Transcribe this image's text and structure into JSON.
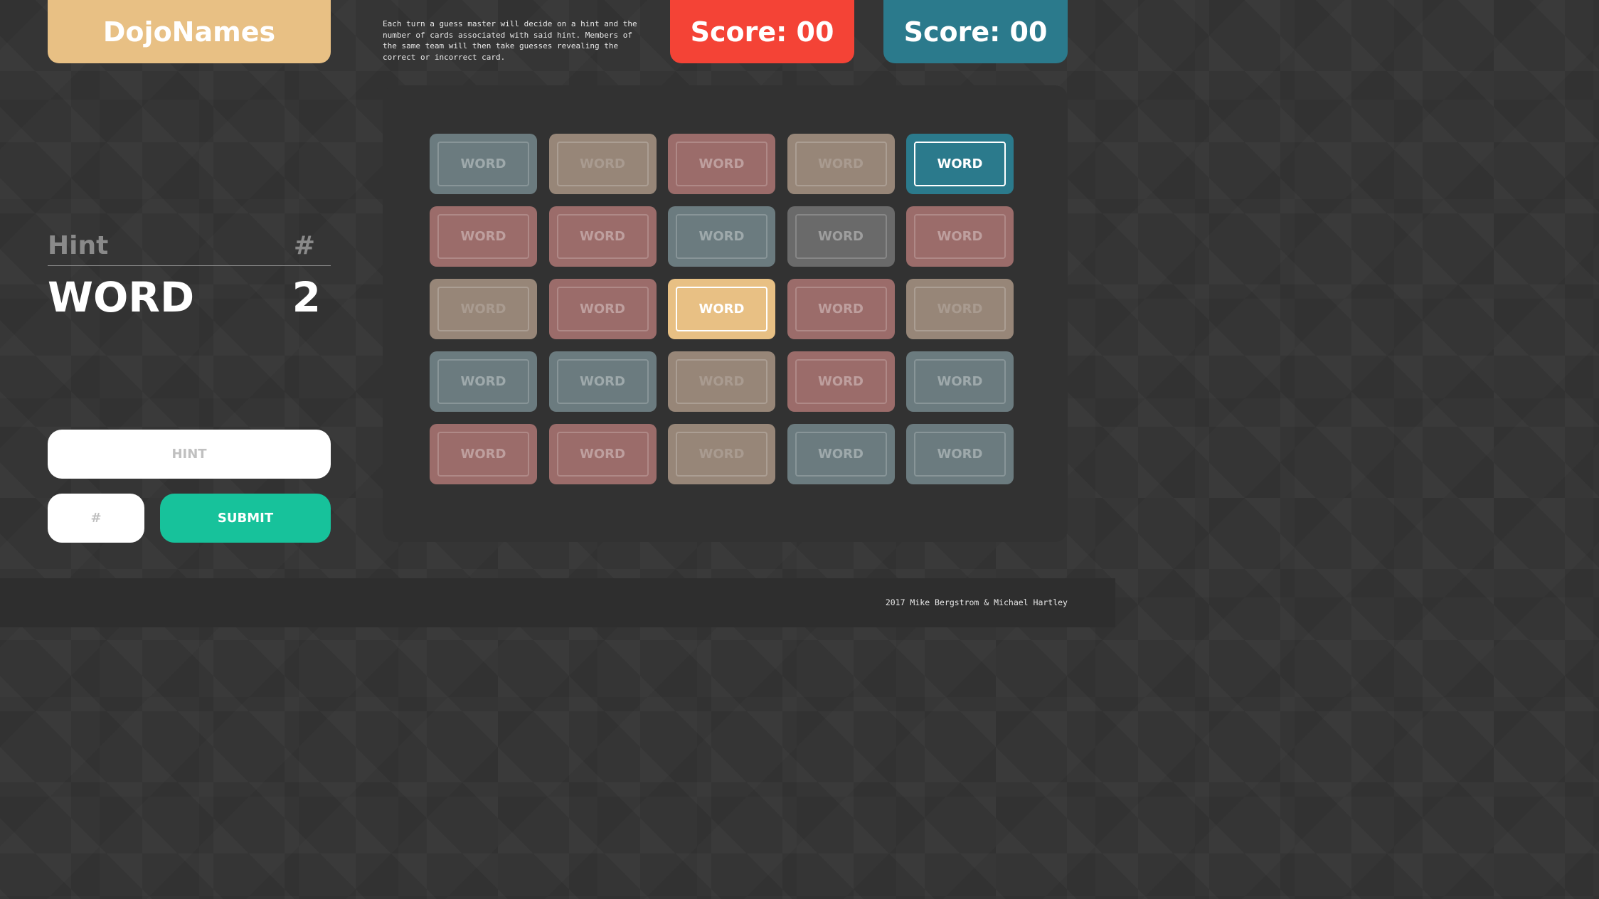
{
  "header": {
    "logo": "DojoNames",
    "instructions": "Each turn a guess master will decide on a hint and the number of cards associated with said hint. Members of the same team will then take guesses revealing the correct or incorrect card.",
    "score_red": "Score: 00",
    "score_blue": "Score: 00"
  },
  "hint_panel": {
    "hint_label": "Hint",
    "count_label": "#",
    "hint_word": "WORD",
    "hint_count": "2"
  },
  "form": {
    "hint_placeholder": "HINT",
    "count_placeholder": "#",
    "submit_label": "SUBMIT"
  },
  "colors": {
    "red_team": "#f44336",
    "blue_team": "#2b7a8c",
    "accent_gold": "#e8c084",
    "submit_green": "#17c29b"
  },
  "cards": [
    {
      "word": "WORD",
      "color": "slate"
    },
    {
      "word": "WORD",
      "color": "tan"
    },
    {
      "word": "WORD",
      "color": "rose"
    },
    {
      "word": "WORD",
      "color": "tan"
    },
    {
      "word": "WORD",
      "color": "blue",
      "revealed": true
    },
    {
      "word": "WORD",
      "color": "rose"
    },
    {
      "word": "WORD",
      "color": "rose"
    },
    {
      "word": "WORD",
      "color": "slate"
    },
    {
      "word": "WORD",
      "color": "gray"
    },
    {
      "word": "WORD",
      "color": "rose"
    },
    {
      "word": "WORD",
      "color": "tan"
    },
    {
      "word": "WORD",
      "color": "rose"
    },
    {
      "word": "WORD",
      "color": "gold",
      "revealed": true
    },
    {
      "word": "WORD",
      "color": "rose"
    },
    {
      "word": "WORD",
      "color": "tan"
    },
    {
      "word": "WORD",
      "color": "slate"
    },
    {
      "word": "WORD",
      "color": "slate"
    },
    {
      "word": "WORD",
      "color": "tan"
    },
    {
      "word": "WORD",
      "color": "rose"
    },
    {
      "word": "WORD",
      "color": "slate"
    },
    {
      "word": "WORD",
      "color": "rose"
    },
    {
      "word": "WORD",
      "color": "rose"
    },
    {
      "word": "WORD",
      "color": "tan"
    },
    {
      "word": "WORD",
      "color": "slate"
    },
    {
      "word": "WORD",
      "color": "slate"
    }
  ],
  "footer": {
    "credit": "2017 Mike Bergstrom & Michael Hartley"
  }
}
